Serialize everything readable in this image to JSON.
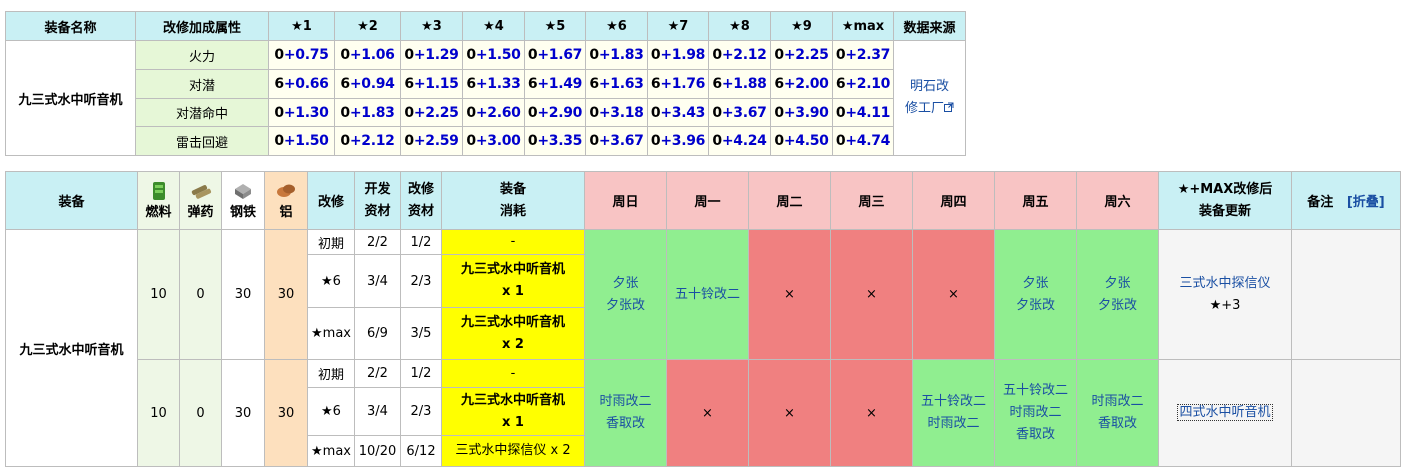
{
  "table1": {
    "headers": [
      "装备名称",
      "改修加成属性",
      "★1",
      "★2",
      "★3",
      "★4",
      "★5",
      "★6",
      "★7",
      "★8",
      "★9",
      "★max",
      "数据来源"
    ],
    "equip_name": "九三式水中听音机",
    "rows": [
      {
        "attr": "火力",
        "base": "0",
        "vals": [
          "+0.75",
          "+1.06",
          "+1.29",
          "+1.50",
          "+1.67",
          "+1.83",
          "+1.98",
          "+2.12",
          "+2.25",
          "+2.37"
        ]
      },
      {
        "attr": "对潜",
        "base": "6",
        "vals": [
          "+0.66",
          "+0.94",
          "+1.15",
          "+1.33",
          "+1.49",
          "+1.63",
          "+1.76",
          "+1.88",
          "+2.00",
          "+2.10"
        ]
      },
      {
        "attr": "对潜命中",
        "base": "0",
        "vals": [
          "+1.30",
          "+1.83",
          "+2.25",
          "+2.60",
          "+2.90",
          "+3.18",
          "+3.43",
          "+3.67",
          "+3.90",
          "+4.11"
        ]
      },
      {
        "attr": "雷击回避",
        "base": "0",
        "vals": [
          "+1.50",
          "+2.12",
          "+2.59",
          "+3.00",
          "+3.35",
          "+3.67",
          "+3.96",
          "+4.24",
          "+4.50",
          "+4.74"
        ]
      }
    ],
    "source_line1": "明石改",
    "source_line2": "修工厂",
    "source_icon": "external-link-icon"
  },
  "table2": {
    "h_equip": "装备",
    "h_fuel": "燃料",
    "h_ammo": "弹药",
    "h_steel": "钢铁",
    "h_alu": "铝",
    "h_kaishu": "改修",
    "h_dev1": "开发",
    "h_dev2": "资材",
    "h_mod1": "改修",
    "h_mod2": "资材",
    "h_eq1": "装备",
    "h_eq2": "消耗",
    "days": [
      "周日",
      "周一",
      "周二",
      "周三",
      "周四",
      "周五",
      "周六"
    ],
    "h_after1": "★+MAX改修后",
    "h_after2": "装备更新",
    "h_note": "备注",
    "fold_label": "[折叠]",
    "equip_name": "九三式水中听音机",
    "icon_colors": {
      "fuel": "#3c8c2c",
      "ammo": "#8a7a4a",
      "steel": "#8c8c8c",
      "alu": "#c8783c"
    },
    "groups": [
      {
        "fuel": "10",
        "ammo": "0",
        "steel": "30",
        "alu": "30",
        "stages": [
          {
            "stage": "初期",
            "dev": "2/2",
            "mod": "1/2",
            "eq_line1": "-",
            "eq_line2": ""
          },
          {
            "stage": "★6",
            "dev": "3/4",
            "mod": "2/3",
            "eq_line1": "九三式水中听音机",
            "eq_line2": "x 1"
          },
          {
            "stage": "★max",
            "dev": "6/9",
            "mod": "3/5",
            "eq_line1": "九三式水中听音机",
            "eq_line2": "x 2"
          }
        ],
        "days": [
          {
            "ok": true,
            "lines": [
              "夕张",
              "夕张改"
            ]
          },
          {
            "ok": true,
            "lines": [
              "五十铃改二"
            ]
          },
          {
            "ok": false,
            "lines": [
              "×"
            ]
          },
          {
            "ok": false,
            "lines": [
              "×"
            ]
          },
          {
            "ok": false,
            "lines": [
              "×"
            ]
          },
          {
            "ok": true,
            "lines": [
              "夕张",
              "夕张改"
            ]
          },
          {
            "ok": true,
            "lines": [
              "夕张",
              "夕张改"
            ]
          }
        ],
        "after_line1": "三式水中探信仪",
        "after_line2": "★+3"
      },
      {
        "fuel": "10",
        "ammo": "0",
        "steel": "30",
        "alu": "30",
        "stages": [
          {
            "stage": "初期",
            "dev": "2/2",
            "mod": "1/2",
            "eq_line1": "-",
            "eq_line2": ""
          },
          {
            "stage": "★6",
            "dev": "3/4",
            "mod": "2/3",
            "eq_line1": "九三式水中听音机",
            "eq_line2": "x 1"
          },
          {
            "stage": "★max",
            "dev": "10/20",
            "mod": "6/12",
            "eq_line1": "三式水中探信仪 x 2",
            "eq_line2": ""
          }
        ],
        "days": [
          {
            "ok": true,
            "lines": [
              "时雨改二",
              "香取改"
            ]
          },
          {
            "ok": false,
            "lines": [
              "×"
            ]
          },
          {
            "ok": false,
            "lines": [
              "×"
            ]
          },
          {
            "ok": false,
            "lines": [
              "×"
            ]
          },
          {
            "ok": true,
            "lines": [
              "五十铃改二",
              "时雨改二"
            ]
          },
          {
            "ok": true,
            "lines": [
              "五十铃改二",
              "时雨改二",
              "香取改"
            ]
          },
          {
            "ok": true,
            "lines": [
              "时雨改二",
              "香取改"
            ]
          }
        ],
        "after_line1": "四式水中听音机",
        "after_line2": ""
      }
    ]
  }
}
